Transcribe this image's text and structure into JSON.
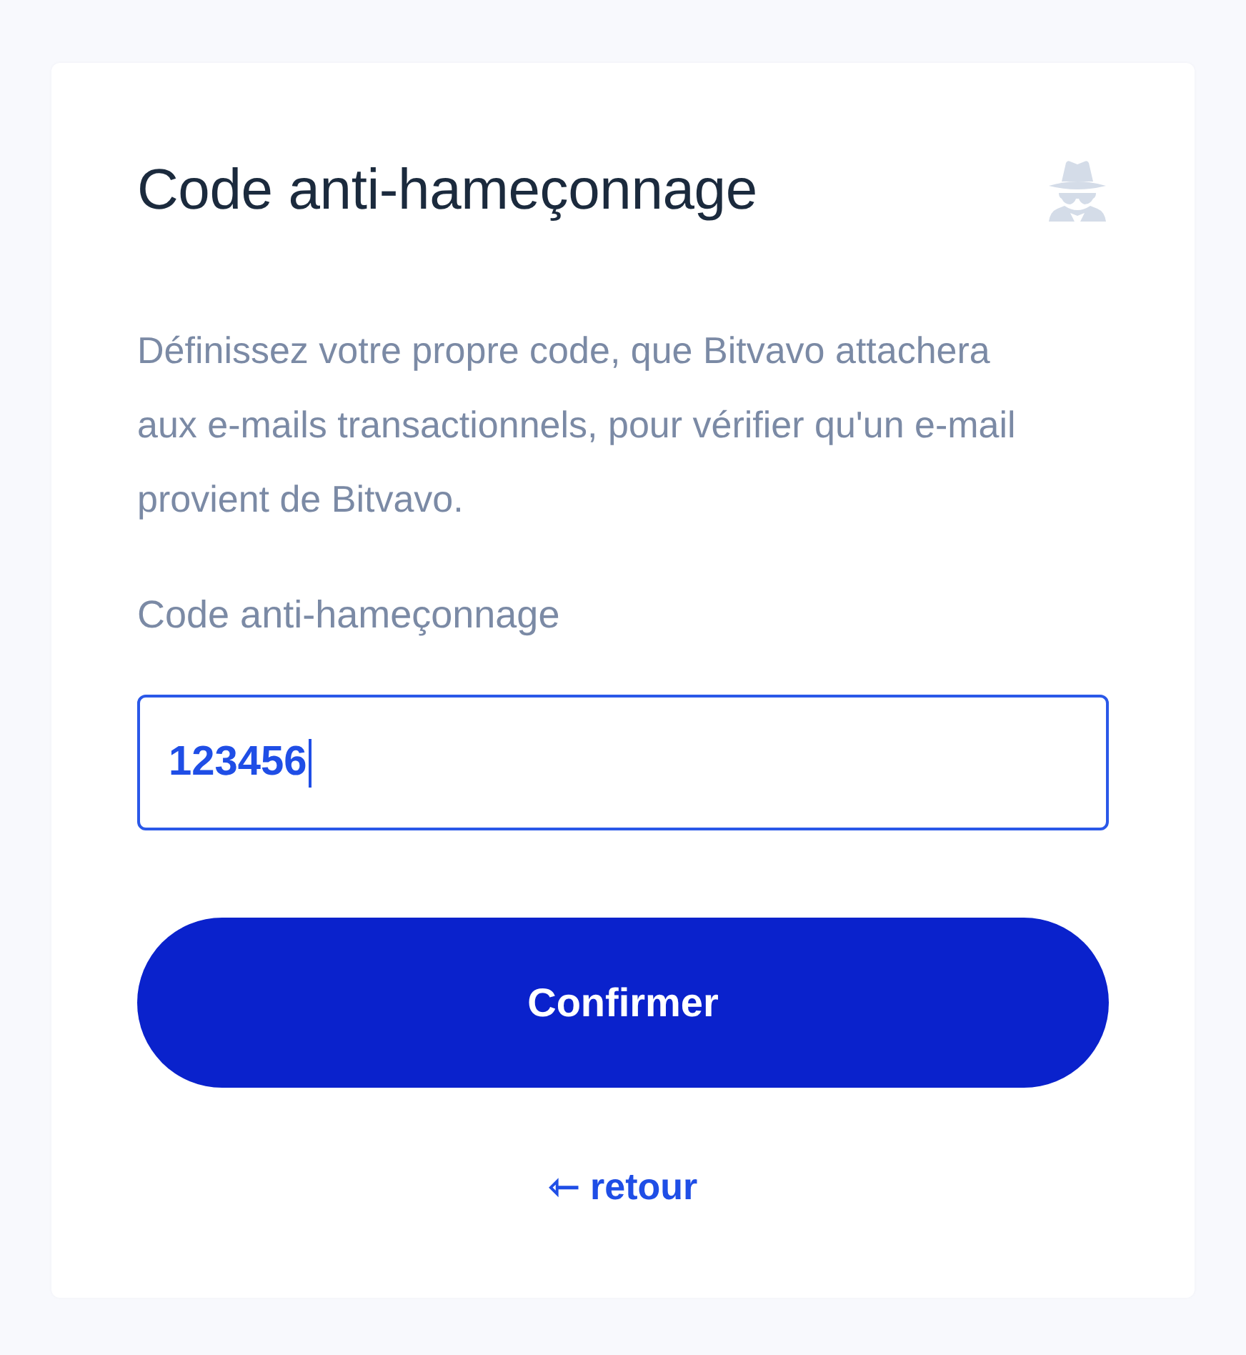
{
  "card": {
    "title": "Code anti-hameçonnage",
    "description": "Définissez votre propre code, que Bitvavo attachera aux e-mails transactionnels, pour vérifier qu'un e-mail provient de Bitvavo.",
    "field": {
      "label": "Code anti-hameçonnage",
      "value": "123456",
      "focused": true
    },
    "button": {
      "label": "Confirmer"
    },
    "back_link": {
      "label": "⇽ retour"
    }
  }
}
